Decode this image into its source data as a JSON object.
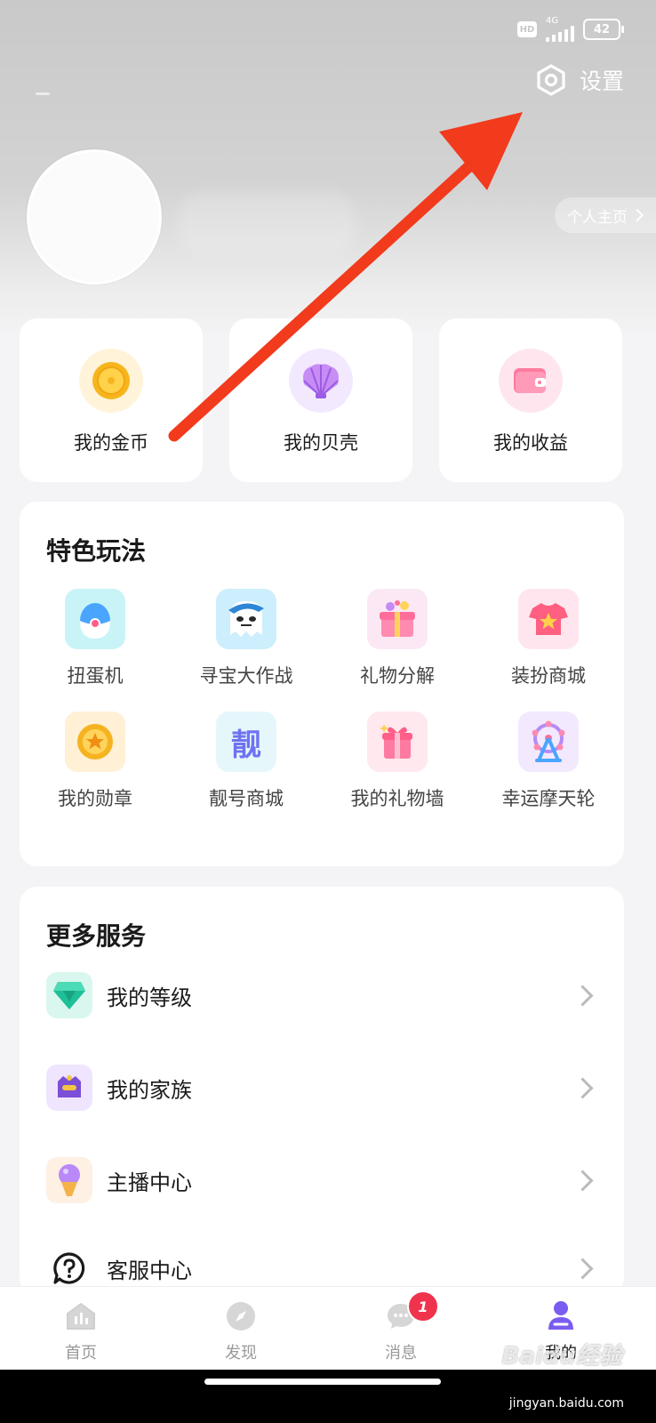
{
  "status_bar": {
    "hd": "HD",
    "network": "4G",
    "battery": "42"
  },
  "header": {
    "settings_label": "设置",
    "profile_link": "个人主页"
  },
  "assets": [
    {
      "label": "我的金币",
      "icon": "coin-icon"
    },
    {
      "label": "我的贝壳",
      "icon": "shell-icon"
    },
    {
      "label": "我的收益",
      "icon": "wallet-icon"
    }
  ],
  "features": {
    "title": "特色玩法",
    "items": [
      {
        "label": "扭蛋机",
        "icon": "gacha-egg-icon"
      },
      {
        "label": "寻宝大作战",
        "icon": "treasure-ghost-icon"
      },
      {
        "label": "礼物分解",
        "icon": "gift-box-icon"
      },
      {
        "label": "装扮商城",
        "icon": "tshirt-star-icon"
      },
      {
        "label": "我的勋章",
        "icon": "medal-icon"
      },
      {
        "label": "靓号商城",
        "icon": "pretty-number-icon",
        "glyph": "靓"
      },
      {
        "label": "我的礼物墙",
        "icon": "gift-wall-icon"
      },
      {
        "label": "幸运摩天轮",
        "icon": "ferris-wheel-icon"
      }
    ]
  },
  "services": {
    "title": "更多服务",
    "items": [
      {
        "label": "我的等级",
        "icon": "diamond-level-icon"
      },
      {
        "label": "我的家族",
        "icon": "family-badge-icon"
      },
      {
        "label": "主播中心",
        "icon": "microphone-icon"
      },
      {
        "label": "客服中心",
        "icon": "help-chat-icon"
      }
    ]
  },
  "tabbar": {
    "items": [
      {
        "label": "首页",
        "icon": "home-icon"
      },
      {
        "label": "发现",
        "icon": "compass-icon"
      },
      {
        "label": "消息",
        "icon": "message-icon",
        "badge": "1"
      },
      {
        "label": "我的",
        "icon": "profile-icon",
        "active": true
      }
    ]
  },
  "watermark": {
    "brand": "Baidu经验",
    "url": "jingyan.baidu.com"
  },
  "colors": {
    "accent": "#7b5cf0",
    "annotation_arrow": "#f23a1c",
    "badge": "#f0334d"
  }
}
